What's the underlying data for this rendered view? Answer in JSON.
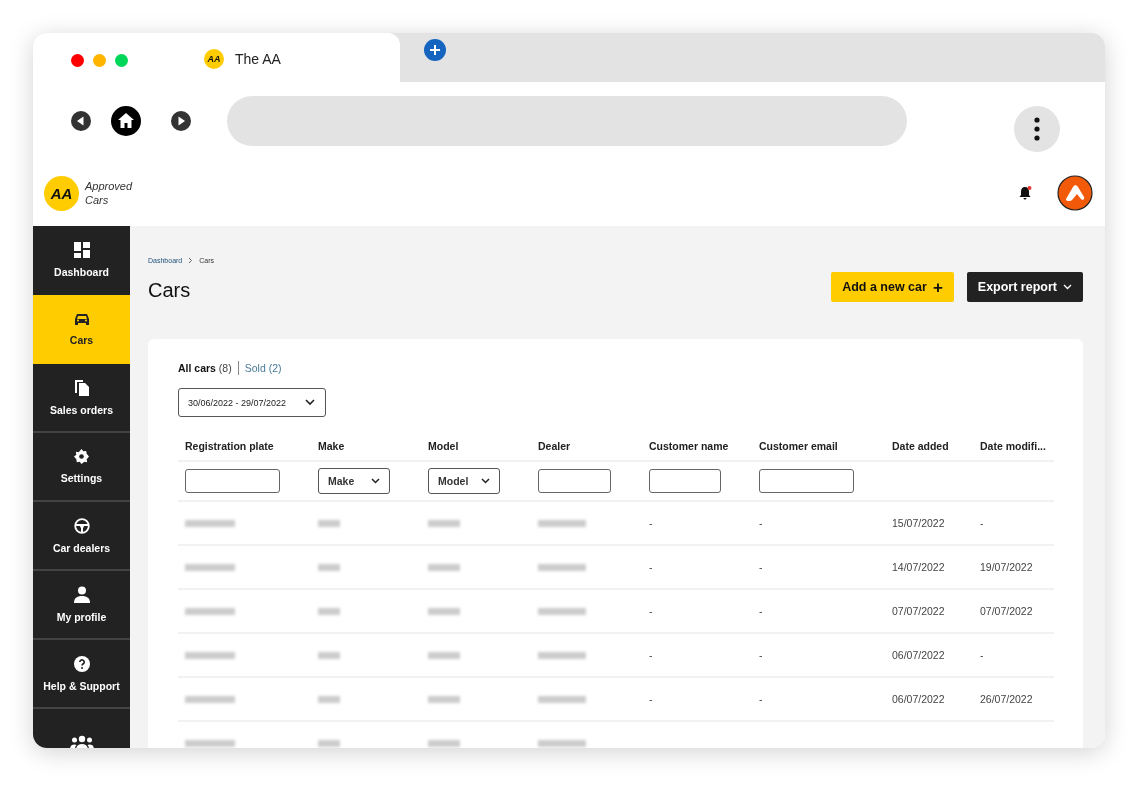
{
  "browser": {
    "tab_logo_text": "AA",
    "tab_title": "The AA"
  },
  "header": {
    "logo_text": "AA",
    "brand": "Approved",
    "brand_line2": "Cars",
    "notification": true
  },
  "sidebar": {
    "items": [
      {
        "label": "Dashboard",
        "selected": false
      },
      {
        "label": "Cars",
        "selected": true
      },
      {
        "label": "Sales orders",
        "selected": false
      },
      {
        "label": "Settings",
        "selected": false
      },
      {
        "label": "Car dealers",
        "selected": false
      },
      {
        "label": "My profile",
        "selected": false
      },
      {
        "label": "Help & Support",
        "selected": false
      },
      {
        "selected": false
      }
    ]
  },
  "breadcrumb": [
    "Dashboard",
    "Cars"
  ],
  "page_title": "Cars",
  "actions": [
    {
      "kind": "primary",
      "label": "Add a new car",
      "icon": "+"
    },
    {
      "kind": "dark",
      "label": "Export report"
    }
  ],
  "filter_tabs": [
    {
      "label": "All cars",
      "count": "(8)",
      "selected": true
    },
    {
      "label": "Sold",
      "count": "(2)",
      "selected": false
    }
  ],
  "date_range": "30/06/2022 - 29/07/2022",
  "table": {
    "columns": [
      "Registration plate",
      "Make",
      "Model",
      "Dealer",
      "Customer name",
      "Customer email",
      "Date added",
      "Date modifi..."
    ],
    "filters": [
      {
        "kind": "input"
      },
      {
        "kind": "select",
        "label": "Make"
      },
      {
        "kind": "select",
        "label": "Model"
      },
      {
        "kind": "input"
      },
      {
        "kind": "input"
      },
      {
        "kind": "input"
      },
      {
        "kind": "none"
      },
      {
        "kind": "none"
      }
    ],
    "rows": [
      {
        "cells": [
          {
            "kind": "blurred"
          },
          {
            "kind": "blurred"
          },
          {
            "kind": "blurred"
          },
          {
            "kind": "blurred"
          },
          {
            "kind": "text",
            "text": "-"
          },
          {
            "kind": "text",
            "text": "-"
          },
          {
            "kind": "text",
            "text": "15/07/2022"
          },
          {
            "kind": "text",
            "text": "-"
          }
        ]
      },
      {
        "cells": [
          {
            "kind": "blurred"
          },
          {
            "kind": "blurred"
          },
          {
            "kind": "blurred"
          },
          {
            "kind": "blurred"
          },
          {
            "kind": "text",
            "text": "-"
          },
          {
            "kind": "text",
            "text": "-"
          },
          {
            "kind": "text",
            "text": "14/07/2022"
          },
          {
            "kind": "text",
            "text": "19/07/2022"
          }
        ]
      },
      {
        "cells": [
          {
            "kind": "blurred"
          },
          {
            "kind": "blurred"
          },
          {
            "kind": "blurred"
          },
          {
            "kind": "blurred"
          },
          {
            "kind": "text",
            "text": "-"
          },
          {
            "kind": "text",
            "text": "-"
          },
          {
            "kind": "text",
            "text": "07/07/2022"
          },
          {
            "kind": "text",
            "text": "07/07/2022"
          }
        ]
      },
      {
        "cells": [
          {
            "kind": "blurred"
          },
          {
            "kind": "blurred"
          },
          {
            "kind": "blurred"
          },
          {
            "kind": "blurred"
          },
          {
            "kind": "text",
            "text": "-"
          },
          {
            "kind": "text",
            "text": "-"
          },
          {
            "kind": "text",
            "text": "06/07/2022"
          },
          {
            "kind": "text",
            "text": "-"
          }
        ]
      },
      {
        "cells": [
          {
            "kind": "blurred"
          },
          {
            "kind": "blurred"
          },
          {
            "kind": "blurred"
          },
          {
            "kind": "blurred"
          },
          {
            "kind": "text",
            "text": "-"
          },
          {
            "kind": "text",
            "text": "-"
          },
          {
            "kind": "text",
            "text": "06/07/2022"
          },
          {
            "kind": "text",
            "text": "26/07/2022"
          }
        ]
      },
      {
        "cells": [
          {
            "kind": "blurred"
          },
          {
            "kind": "blurred"
          },
          {
            "kind": "blurred"
          },
          {
            "kind": "blurred"
          },
          {
            "kind": "none"
          },
          {
            "kind": "none"
          },
          {
            "kind": "none"
          },
          {
            "kind": "none"
          }
        ]
      }
    ]
  }
}
